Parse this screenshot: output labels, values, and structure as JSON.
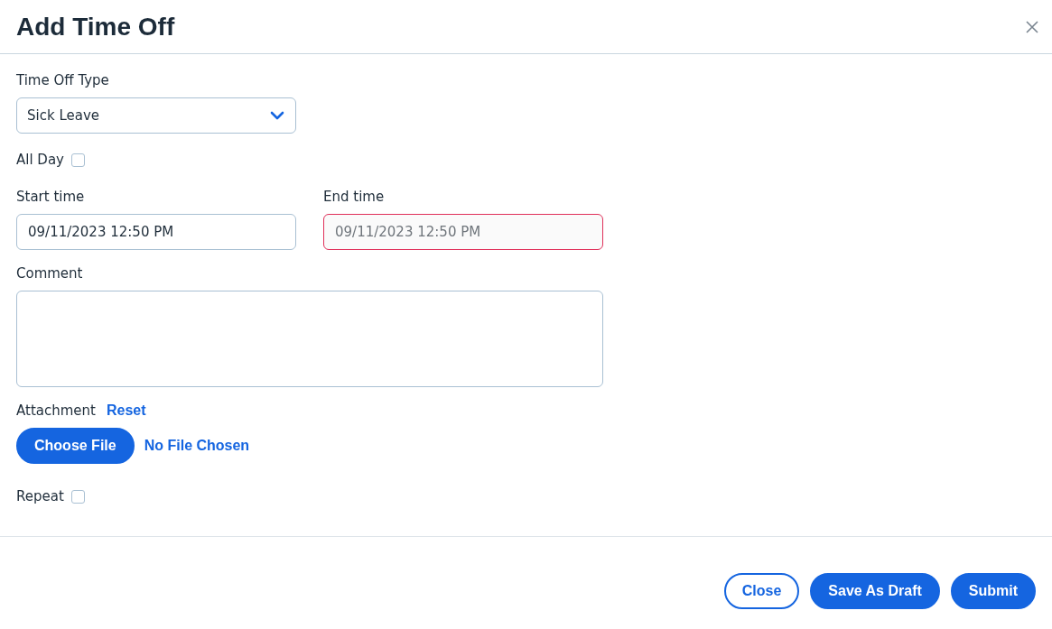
{
  "dialog": {
    "title": "Add Time Off"
  },
  "time_off_type": {
    "label": "Time Off Type",
    "value": "Sick Leave"
  },
  "all_day": {
    "label": "All Day",
    "checked": false
  },
  "start_time": {
    "label": "Start time",
    "value": "09/11/2023 12:50 PM",
    "disabled": false,
    "invalid": false
  },
  "end_time": {
    "label": "End time",
    "value": "09/11/2023 12:50 PM",
    "disabled": true,
    "invalid": true
  },
  "comment": {
    "label": "Comment"
  },
  "attachment": {
    "label": "Attachment",
    "reset": "Reset",
    "button": "Choose File",
    "status": "No File Chosen"
  },
  "repeat": {
    "label": "Repeat",
    "checked": false
  },
  "buttons": [
    {
      "label": "Close",
      "kind": "outline"
    },
    {
      "label": "Save As Draft",
      "kind": "primary"
    },
    {
      "label": "Submit",
      "kind": "primary"
    }
  ]
}
